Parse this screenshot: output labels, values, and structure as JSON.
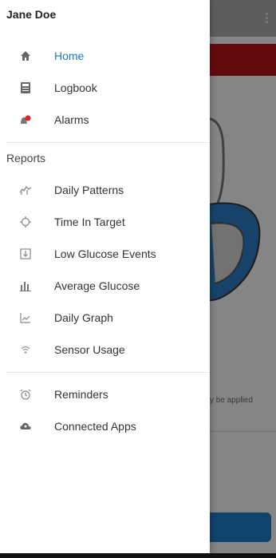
{
  "user": {
    "name": "Jane Doe"
  },
  "menu_top": [
    {
      "label": "Home",
      "icon": "home-icon",
      "active": true
    },
    {
      "label": "Logbook",
      "icon": "logbook-icon"
    },
    {
      "label": "Alarms",
      "icon": "alarm-bell-icon"
    }
  ],
  "reports_heading": "Reports",
  "reports": [
    {
      "label": "Daily Patterns",
      "icon": "daily-patterns-icon"
    },
    {
      "label": "Time In Target",
      "icon": "target-icon"
    },
    {
      "label": "Low Glucose Events",
      "icon": "low-glucose-icon"
    },
    {
      "label": "Average Glucose",
      "icon": "bar-chart-icon"
    },
    {
      "label": "Daily Graph",
      "icon": "line-graph-icon"
    },
    {
      "label": "Sensor Usage",
      "icon": "sensor-icon"
    }
  ],
  "menu_bottom": [
    {
      "label": "Reminders",
      "icon": "alarm-clock-icon"
    },
    {
      "label": "Connected Apps",
      "icon": "cloud-icon"
    }
  ],
  "background": {
    "partial_text": "y be applied"
  },
  "colors": {
    "accent": "#1e78c8",
    "banner": "#b31417",
    "alarm_badge": "#e0281e"
  }
}
